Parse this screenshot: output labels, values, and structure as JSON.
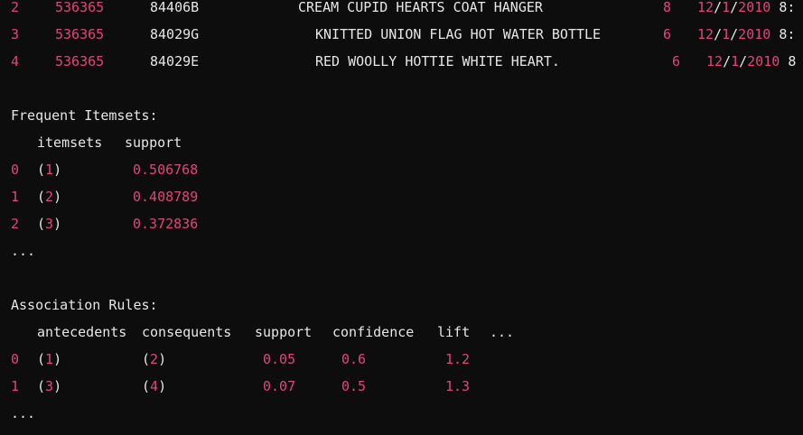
{
  "colors": {
    "background": "#0d0d0d",
    "text": "#e6e6e6",
    "number": "#e0457b"
  },
  "df_rows": [
    {
      "index": "2",
      "invoice": "536365",
      "stock_code": "84406B",
      "description": "CREAM CUPID HEARTS COAT HANGER",
      "quantity": "8",
      "date_m": "12",
      "date_d": "1",
      "date_y": "2010",
      "time": "8:"
    },
    {
      "index": "3",
      "invoice": "536365",
      "stock_code": "84029G",
      "description": "KNITTED UNION FLAG HOT WATER BOTTLE",
      "quantity": "6",
      "date_m": "12",
      "date_d": "1",
      "date_y": "2010",
      "time": "8:"
    },
    {
      "index": "4",
      "invoice": "536365",
      "stock_code": "84029E",
      "description": "RED WOOLLY HOTTIE WHITE HEART.",
      "quantity": "6",
      "date_m": "12",
      "date_d": "1",
      "date_y": "2010",
      "time": "8"
    }
  ],
  "frequent": {
    "heading": "Frequent Itemsets:",
    "col_itemsets": "itemsets",
    "col_support": "support",
    "rows": [
      {
        "index": "0",
        "item": "1",
        "support": "0.506768"
      },
      {
        "index": "1",
        "item": "2",
        "support": "0.408789"
      },
      {
        "index": "2",
        "item": "3",
        "support": "0.372836"
      }
    ],
    "ellipsis": "..."
  },
  "rules": {
    "heading": "Association Rules:",
    "col_antecedents": "antecedents",
    "col_consequents": "consequents",
    "col_support": "support",
    "col_confidence": "confidence",
    "col_lift": "lift",
    "col_more": "...",
    "rows": [
      {
        "index": "0",
        "antecedent": "1",
        "consequent": "2",
        "support": "0.05",
        "confidence": "0.6",
        "lift": "1.2"
      },
      {
        "index": "1",
        "antecedent": "3",
        "consequent": "4",
        "support": "0.07",
        "confidence": "0.5",
        "lift": "1.3"
      }
    ],
    "ellipsis": "..."
  }
}
